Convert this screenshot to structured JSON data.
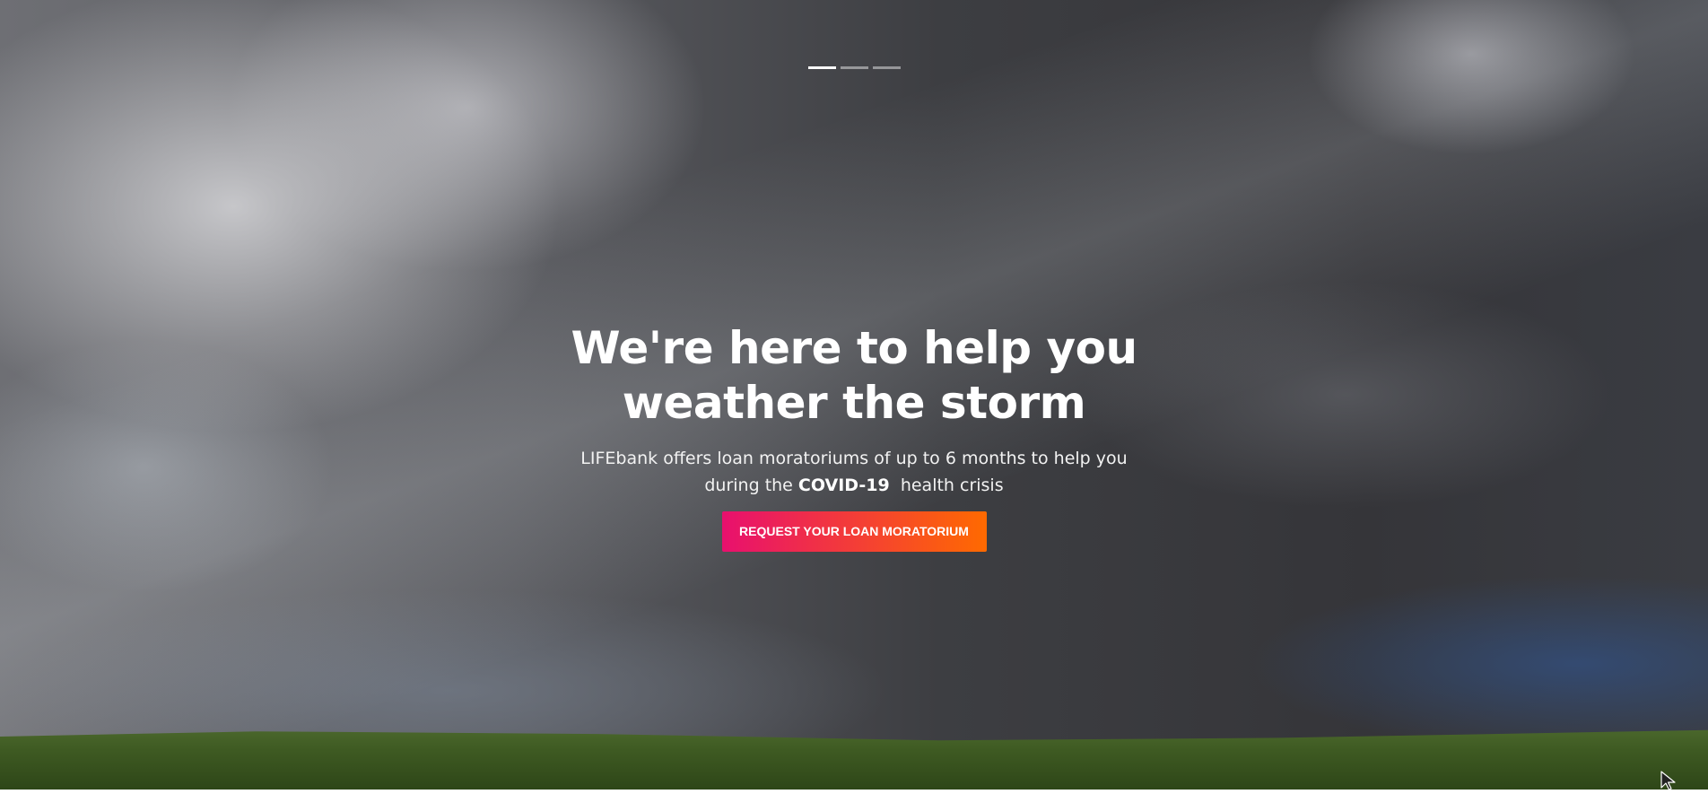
{
  "hero": {
    "slider": {
      "total_slides": 3,
      "active_slide": 1
    },
    "headline_line1": "We're here to help you",
    "headline_line2": "weather the storm",
    "subtitle_line1": "LIFEbank offers loan moratoriums of up to 6 months to help you",
    "subtitle_line2_prefix": "during the ",
    "subtitle_line2_strong": "COVID-19",
    "subtitle_line2_suffix": "  health crisis",
    "cta_label": "REQUEST YOUR LOAN MORATORIUM"
  },
  "colors": {
    "cta_gradient_start": "#e8106e",
    "cta_gradient_end": "#ff6a00",
    "text": "#ffffff"
  },
  "icons": {
    "pointer": "mouse-cursor-icon"
  }
}
